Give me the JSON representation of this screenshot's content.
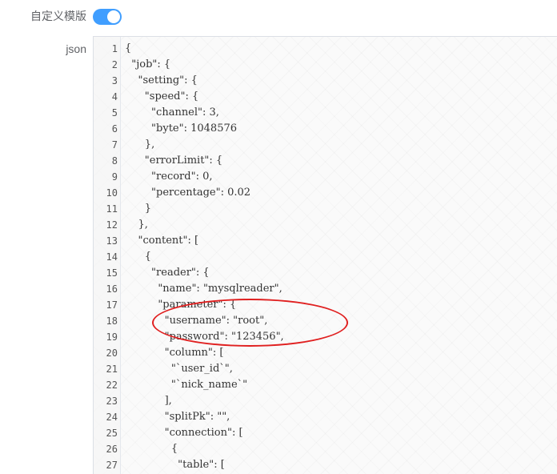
{
  "form": {
    "template_label": "自定义模版",
    "template_switch_on": true,
    "json_label": "json"
  },
  "editor": {
    "lines": [
      "{",
      "  \"job\": {",
      "    \"setting\": {",
      "      \"speed\": {",
      "        \"channel\": 3,",
      "        \"byte\": 1048576",
      "      },",
      "      \"errorLimit\": {",
      "        \"record\": 0,",
      "        \"percentage\": 0.02",
      "      }",
      "    },",
      "    \"content\": [",
      "      {",
      "        \"reader\": {",
      "          \"name\": \"mysqlreader\",",
      "          \"parameter\": {",
      "            \"username\": \"root\",",
      "            \"password\": \"123456\",",
      "            \"column\": [",
      "              \"`user_id`\",",
      "              \"`nick_name`\"",
      "            ],",
      "            \"splitPk\": \"\",",
      "            \"connection\": [",
      "              {",
      "                \"table\": ["
    ]
  },
  "annotation": {
    "color": "#e02020",
    "shape": "ellipse",
    "highlights": "username/password lines"
  }
}
